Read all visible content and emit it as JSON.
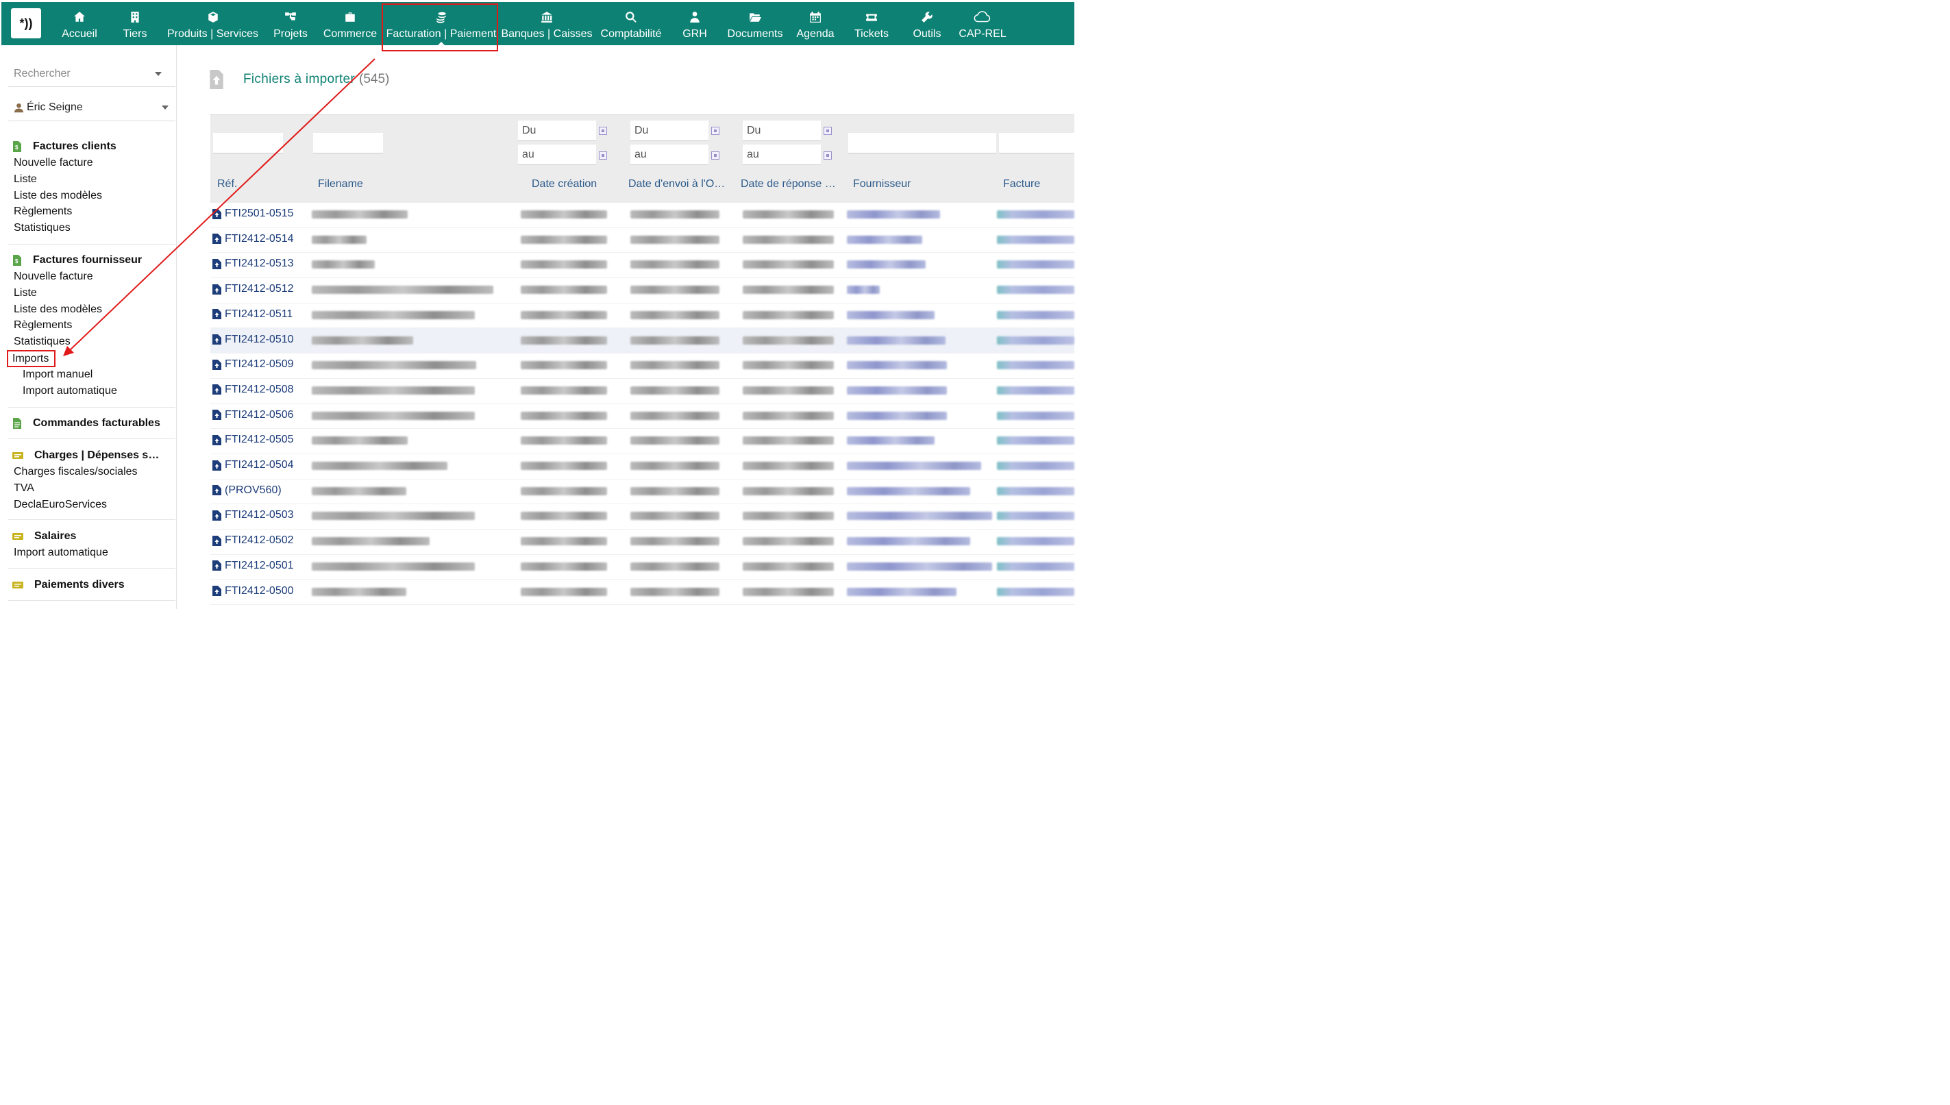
{
  "topnav": {
    "logo_text": "*))",
    "items": [
      {
        "label": "Accueil",
        "icon": "home-icon"
      },
      {
        "label": "Tiers",
        "icon": "building-icon"
      },
      {
        "label": "Produits | Services",
        "icon": "cube-icon"
      },
      {
        "label": "Projets",
        "icon": "sitemap-icon"
      },
      {
        "label": "Commerce",
        "icon": "briefcase-icon"
      },
      {
        "label": "Facturation | Paiement",
        "icon": "coins-icon",
        "active": true
      },
      {
        "label": "Banques | Caisses",
        "icon": "bank-icon"
      },
      {
        "label": "Comptabilité",
        "icon": "search-dollar-icon"
      },
      {
        "label": "GRH",
        "icon": "user-tie-icon"
      },
      {
        "label": "Documents",
        "icon": "folder-open-icon"
      },
      {
        "label": "Agenda",
        "icon": "calendar-icon"
      },
      {
        "label": "Tickets",
        "icon": "ticket-icon"
      },
      {
        "label": "Outils",
        "icon": "wrench-icon"
      },
      {
        "label": "CAP-REL",
        "icon": "cloud-icon"
      }
    ]
  },
  "sidebar": {
    "search_placeholder": "Rechercher",
    "user_name": "Éric Seigne",
    "sections": [
      {
        "title": "Factures clients",
        "links": [
          "Nouvelle facture",
          "Liste",
          "Liste des modèles",
          "Règlements",
          "Statistiques"
        ]
      },
      {
        "title": "Factures fournisseur",
        "links": [
          "Nouvelle facture",
          "Liste",
          "Liste des modèles",
          "Règlements",
          "Statistiques"
        ],
        "highlighted": "Imports",
        "sublinks": [
          "Import manuel",
          "Import automatique"
        ]
      },
      {
        "title": "Commandes facturables",
        "links": []
      },
      {
        "title": "Charges | Dépenses s…",
        "links": [
          "Charges fiscales/sociales",
          "TVA",
          "DeclaEuroServices"
        ]
      },
      {
        "title": "Salaires",
        "links": [
          "Import automatique"
        ]
      },
      {
        "title": "Paiements divers",
        "links": []
      }
    ]
  },
  "main": {
    "title": "Fichiers à importer",
    "count": "(545)",
    "filters": {
      "du": "Du",
      "au": "au"
    },
    "columns": [
      "Réf.",
      "Filename",
      "Date création",
      "Date d'envoi à l'O…",
      "Date de réponse …",
      "Fournisseur",
      "Facture"
    ],
    "rows": [
      "FTI2501-0515",
      "FTI2412-0514",
      "FTI2412-0513",
      "FTI2412-0512",
      "FTI2412-0511",
      "FTI2412-0510",
      "FTI2412-0509",
      "FTI2412-0508",
      "FTI2412-0506",
      "FTI2412-0505",
      "FTI2412-0504",
      "(PROV560)",
      "FTI2412-0503",
      "FTI2412-0502",
      "FTI2412-0501",
      "FTI2412-0500"
    ],
    "highlighted_row": 5
  },
  "colors": {
    "accent": "#0d8173",
    "annotation": "#e01a1a",
    "link": "#1d3d7a"
  }
}
